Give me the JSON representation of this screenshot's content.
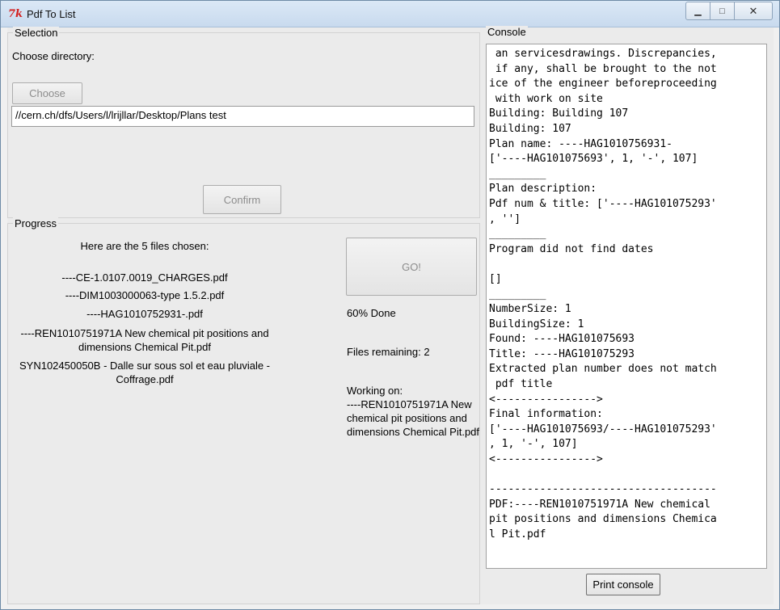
{
  "window": {
    "title": "Pdf To List",
    "icon": "tk-feather-icon"
  },
  "selection": {
    "frame_label": "Selection",
    "choose_dir_label": "Choose directory:",
    "choose_button": "Choose",
    "path_value": "//cern.ch/dfs/Users/l/lrijllar/Desktop/Plans test",
    "confirm_button": "Confirm"
  },
  "progress": {
    "frame_label": "Progress",
    "files_header": "Here are the 5 files chosen:",
    "files": [
      "----CE-1.0107.0019_CHARGES.pdf",
      "----DIM1003000063-type 1.5.2.pdf",
      "----HAG1010752931-.pdf",
      "----REN1010751971A New chemical pit positions and dimensions Chemical Pit.pdf",
      "SYN102450050B - Dalle sur sous sol et eau pluviale - Coffrage.pdf"
    ],
    "go_button": "GO!",
    "percent_done": "60% Done",
    "percent_value": 60,
    "files_remaining": "Files remaining: 2",
    "working_on": "Working on:\n----REN1010751971A New chemical pit positions and dimensions Chemical Pit.pdf"
  },
  "console": {
    "frame_label": "Console",
    "lines": [
      " an servicesdrawings. Discrepancies,",
      " if any, shall be brought to the not",
      "ice of the engineer beforeproceeding",
      " with work on site",
      "Building: Building 107",
      "Building: 107",
      "Plan name: ----HAG1010756931-",
      "['----HAG101075693', 1, '-', 107]",
      "_________",
      "Plan description:",
      "Pdf num & title: ['----HAG101075293'",
      ", '']",
      "_________",
      "Program did not find dates",
      "",
      "[]",
      "_________",
      "NumberSize: 1",
      "BuildingSize: 1",
      "Found: ----HAG101075693",
      "Title: ----HAG101075293",
      "Extracted plan number does not match",
      " pdf title",
      "<---------------->",
      "Final information:",
      "['----HAG101075693/----HAG101075293'",
      ", 1, '-', 107]",
      "<---------------->",
      "",
      "------------------------------------",
      "PDF:----REN1010751971A New chemical",
      "pit positions and dimensions Chemica",
      "l Pit.pdf"
    ],
    "print_button": "Print console"
  }
}
